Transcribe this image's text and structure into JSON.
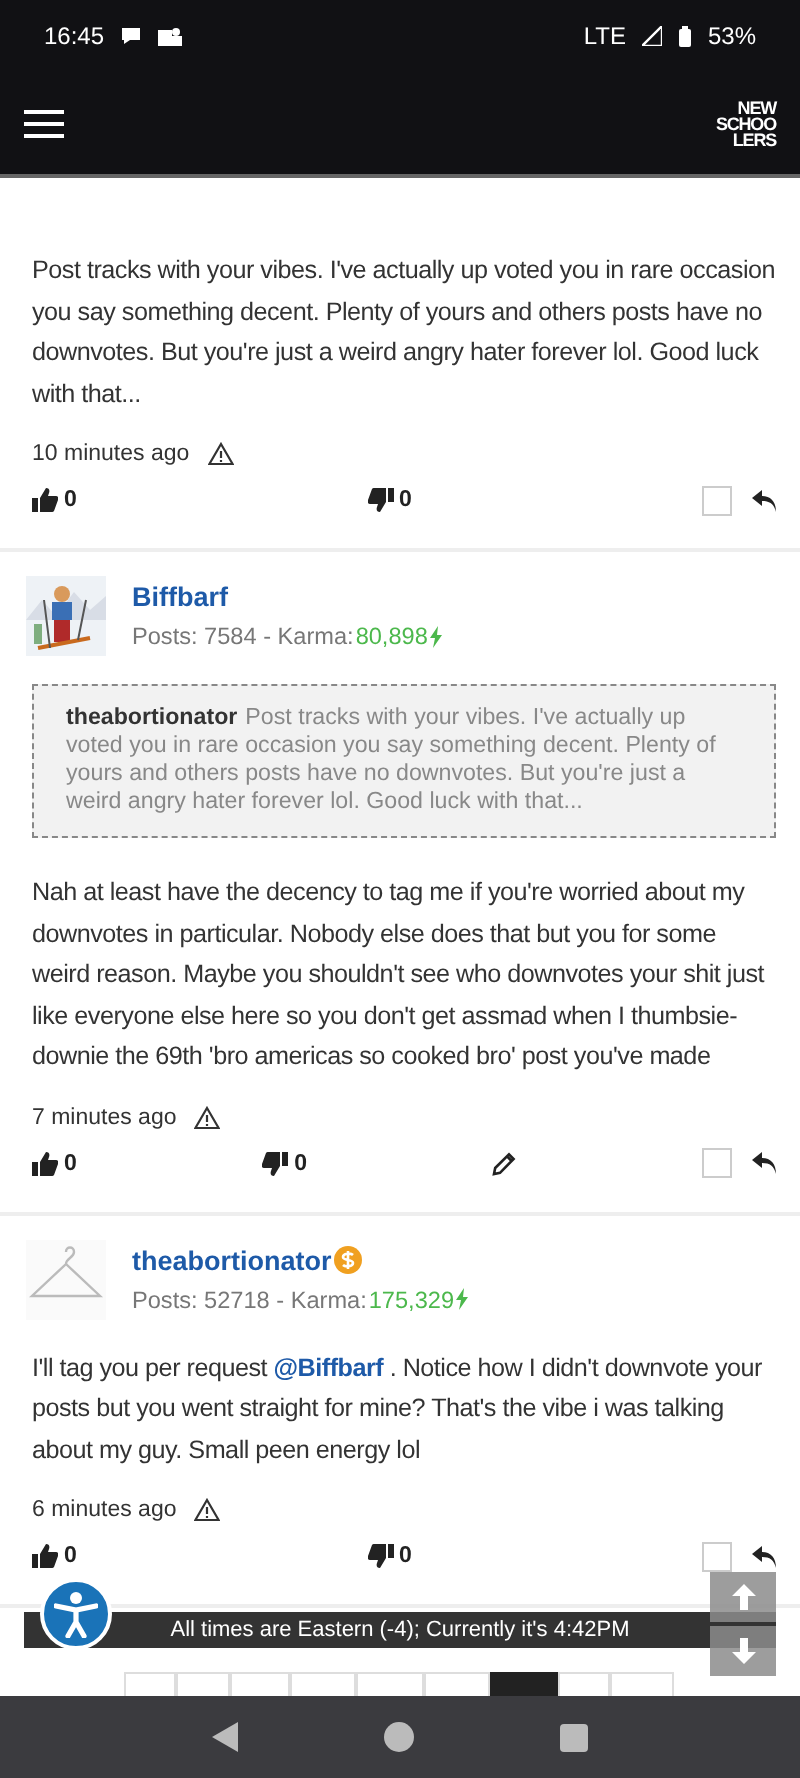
{
  "status_bar": {
    "time": "16:45",
    "network": "LTE",
    "battery": "53%"
  },
  "header": {
    "logo": [
      "NEW",
      "SCHOO",
      "LERS"
    ]
  },
  "posts": [
    {
      "body": [
        {
          "text": "Post tracks with your vibes. I've actually up voted you in rare occasion you say something decent. Plenty of yours and others posts have no downvotes. But you're just a weird angry hater forever lol. Good luck with that..."
        }
      ],
      "time": "10 minutes ago",
      "upvotes": "0",
      "downvotes": "0",
      "editable": false,
      "checked": false
    },
    {
      "author": {
        "name": "Biffbarf",
        "supporter": false,
        "stats": "Posts: 7584 - Karma: ",
        "karma": "80,898"
      },
      "quote": {
        "author": "theabortionator",
        "text": "Post tracks with your vibes. I've actually up voted you in rare occasion you say something decent. Plenty of yours and others posts have no downvotes. But you're just a weird angry hater forever lol. Good luck with that..."
      },
      "body": [
        {
          "text": "Nah at least have the decency to tag me if you're worried about my downvotes in particular. Nobody else does that but you for some weird reason. Maybe you shouldn't see who downvotes your shit just like everyone else here so you don't get assmad when I thumbsie-downie the 69th 'bro americas so cooked bro' post you've made"
        }
      ],
      "time": "7 minutes ago",
      "upvotes": "0",
      "downvotes": "0",
      "editable": true,
      "checked": false
    },
    {
      "author": {
        "name": "theabortionator",
        "supporter": true,
        "stats": "Posts: 52718 - Karma: ",
        "karma": "175,329"
      },
      "body": [
        {
          "text": "I'll tag you per request "
        },
        {
          "text": "@Biffbarf",
          "kind": "mention"
        },
        {
          "text": " . Notice how I didn't downvote your posts but you went straight for mine? That's the vibe i was talking about my guy. Small peen energy lol"
        }
      ],
      "time": "6 minutes ago",
      "upvotes": "0",
      "downvotes": "0",
      "editable": false,
      "checked": false
    }
  ],
  "timezone_bar": "All times are Eastern (-4); Currently it's 4:42PM",
  "pagination": [
    {
      "selected": false
    },
    {
      "selected": false
    },
    {
      "selected": false
    },
    {
      "selected": false
    },
    {
      "selected": false
    },
    {
      "selected": false
    },
    {
      "selected": true
    },
    {
      "selected": false
    },
    {
      "selected": false
    }
  ]
}
